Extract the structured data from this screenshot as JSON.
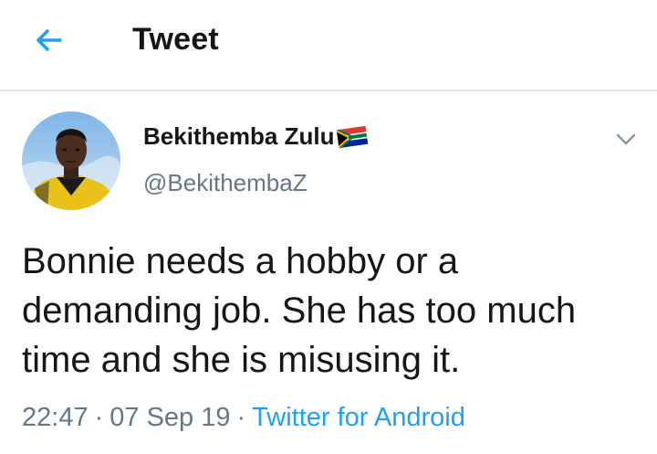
{
  "header": {
    "title": "Tweet",
    "back_icon": "back-arrow-icon",
    "accent_color": "#1da1f2"
  },
  "tweet": {
    "author": {
      "display_name": "Bekithemba Zulu",
      "name_emoji": "south-africa-flag-icon",
      "handle": "@BekithembaZ"
    },
    "text_lines": [
      "Bonnie needs a hobby or a",
      "demanding job. She has too much",
      "time and she is misusing it."
    ],
    "meta": {
      "time": "22:47",
      "separator": "·",
      "date": "07 Sep 19",
      "source": "Twitter for Android"
    },
    "menu_icon": "chevron-down-icon"
  }
}
